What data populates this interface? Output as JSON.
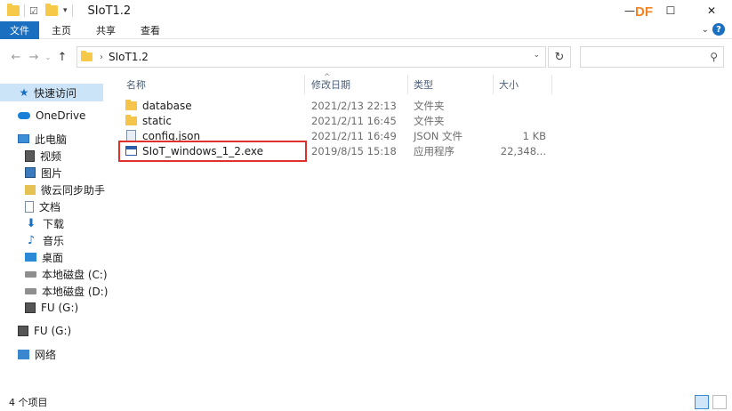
{
  "window": {
    "title": "SIoT1.2",
    "minimize": "—",
    "maximize": "☐",
    "close": "✕",
    "logo_d": "D",
    "logo_f": "F"
  },
  "ribbon": {
    "file_tab": "文件",
    "tabs": [
      "主页",
      "共享",
      "查看"
    ]
  },
  "address": {
    "path": "SIoT1.2",
    "search_placeholder": ""
  },
  "sidebar": {
    "items": [
      {
        "label": "快速访问",
        "icon": "star-icon"
      },
      {
        "label": "OneDrive",
        "icon": "cloud-icon"
      },
      {
        "label": "此电脑",
        "icon": "computer-icon"
      },
      {
        "label": "视频",
        "icon": "video-icon"
      },
      {
        "label": "图片",
        "icon": "pictures-icon"
      },
      {
        "label": "微云同步助手",
        "icon": "weiyun-icon"
      },
      {
        "label": "文档",
        "icon": "documents-icon"
      },
      {
        "label": "下载",
        "icon": "download-icon"
      },
      {
        "label": "音乐",
        "icon": "music-icon"
      },
      {
        "label": "桌面",
        "icon": "desktop-icon"
      },
      {
        "label": "本地磁盘 (C:)",
        "icon": "drive-icon"
      },
      {
        "label": "本地磁盘 (D:)",
        "icon": "drive-icon"
      },
      {
        "label": "FU (G:)",
        "icon": "usb-drive-icon"
      },
      {
        "label": "FU (G:)",
        "icon": "usb-drive-icon"
      },
      {
        "label": "网络",
        "icon": "network-icon"
      }
    ]
  },
  "columns": {
    "name": "名称",
    "date": "修改日期",
    "type": "类型",
    "size": "大小"
  },
  "files": [
    {
      "name": "database",
      "date": "2021/2/13 22:13",
      "type": "文件夹",
      "size": "",
      "icon": "folder-icon"
    },
    {
      "name": "static",
      "date": "2021/2/11 16:45",
      "type": "文件夹",
      "size": "",
      "icon": "folder-icon"
    },
    {
      "name": "config.json",
      "date": "2021/2/11 16:49",
      "type": "JSON 文件",
      "size": "1 KB",
      "icon": "json-file-icon"
    },
    {
      "name": "SIoT_windows_1_2.exe",
      "date": "2019/8/15 15:18",
      "type": "应用程序",
      "size": "22,348...",
      "icon": "exe-file-icon"
    }
  ],
  "status": {
    "count": "4 个项目"
  },
  "colors": {
    "accent": "#1a6fc0",
    "highlight": "#e0302b",
    "folder": "#f5c44a"
  }
}
